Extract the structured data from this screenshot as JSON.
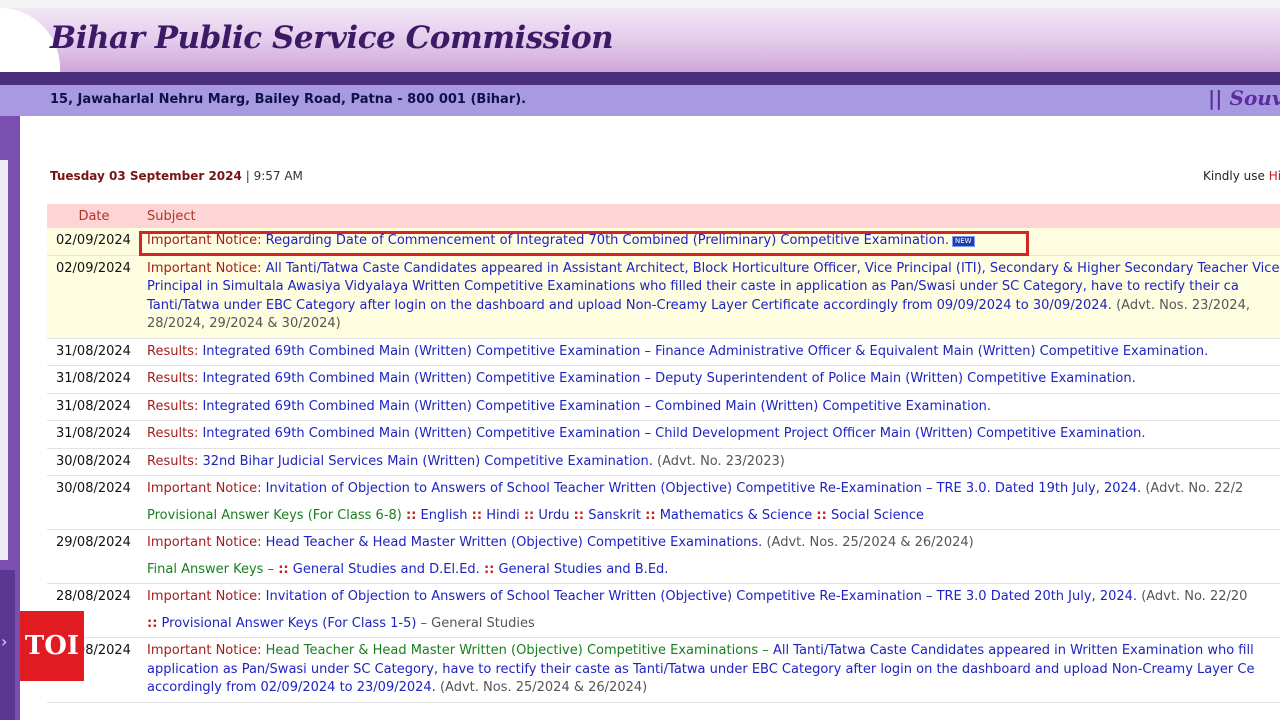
{
  "header": {
    "title": "Bihar Public Service Commission",
    "address": "15, Jawaharlal Nehru Marg, Bailey Road, Patna - 800 001 (Bihar).",
    "souvenir": "|| Souve"
  },
  "info_bar": {
    "date": "Tuesday 03 September 2024",
    "separator": "|",
    "time": "9:57 AM",
    "kindly_text": "Kindly use",
    "kindly_link": "Hin"
  },
  "table": {
    "col_date": "Date",
    "col_subject": "Subject",
    "rows": [
      {
        "date": "02/09/2024",
        "category": "Important Notice:",
        "text": "Regarding Date of Commencement of Integrated 70th Combined (Preliminary) Competitive Examination.",
        "badge": "NEW"
      },
      {
        "date": "02/09/2024",
        "category": "Important Notice:",
        "text": "All Tanti/Tatwa Caste Candidates appeared in Assistant Architect, Block Horticulture Officer, Vice Principal (ITI), Secondary & Higher Secondary Teacher Vice Principal in Simultala Awasiya Vidyalaya Written Competitive Examinations who filled their caste in application as Pan/Swasi under SC Category, have to rectify their ca Tanti/Tatwa under EBC Category after login on the dashboard and upload Non-Creamy Layer Certificate accordingly from 09/09/2024 to 30/09/2024.",
        "advt": "(Advt. Nos. 23/2024, 28/2024, 29/2024 & 30/2024)"
      },
      {
        "date": "31/08/2024",
        "category": "Results:",
        "text": "Integrated 69th Combined Main (Written) Competitive Examination – Finance Administrative Officer & Equivalent Main (Written) Competitive Examination."
      },
      {
        "date": "31/08/2024",
        "category": "Results:",
        "text": "Integrated 69th Combined Main (Written) Competitive Examination – Deputy Superintendent of Police Main (Written) Competitive Examination."
      },
      {
        "date": "31/08/2024",
        "category": "Results:",
        "text": "Integrated 69th Combined Main (Written) Competitive Examination – Combined Main (Written) Competitive Examination."
      },
      {
        "date": "31/08/2024",
        "category": "Results:",
        "text": "Integrated 69th Combined Main (Written) Competitive Examination – Child Development Project Officer Main (Written) Competitive Examination."
      },
      {
        "date": "30/08/2024",
        "category": "Results:",
        "text": "32nd Bihar Judicial Services Main (Written) Competitive Examination.",
        "advt": "(Advt. No. 23/2023)"
      },
      {
        "date": "30/08/2024",
        "category": "Important Notice:",
        "text": "Invitation of Objection to Answers of School Teacher Written (Objective) Competitive Re-Examination – TRE 3.0. Dated 19th July, 2024.",
        "advt": "(Advt. No. 22/2",
        "sub": {
          "label": "Provisional Answer Keys (For Class 6-8)",
          "sep": "::",
          "links": [
            "English",
            "Hindi",
            "Urdu",
            "Sanskrit",
            "Mathematics & Science",
            "Social Science"
          ]
        }
      },
      {
        "date": "29/08/2024",
        "category": "Important Notice:",
        "text": "Head Teacher & Head Master Written (Objective) Competitive Examinations.",
        "advt": "(Advt. Nos. 25/2024 & 26/2024)",
        "sub": {
          "label": "Final Answer Keys –",
          "sep": "::",
          "links": [
            "General Studies and D.El.Ed.",
            "General Studies and B.Ed."
          ]
        }
      },
      {
        "date": "28/08/2024",
        "category": "Important Notice:",
        "text": "Invitation of Objection to Answers of School Teacher Written (Objective) Competitive Re-Examination – TRE 3.0 Dated 20th July, 2024.",
        "advt": "(Advt. No. 22/20",
        "sub": {
          "sep": "::",
          "link": "Provisional Answer Keys (For Class 1-5)",
          "dash": "– General Studies"
        }
      },
      {
        "date": "28/08/2024",
        "category": "Important Notice:",
        "text_green": "Head Teacher & Head Master Written (Objective) Competitive Examinations –",
        "text": "All Tanti/Tatwa Caste Candidates appeared in Written Examination who fill application as Pan/Swasi under SC Category, have to rectify their caste as Tanti/Tatwa under EBC Category after login on the dashboard and upload Non-Creamy Layer Ce accordingly from 02/09/2024 to 23/09/2024.",
        "advt": "(Advt. Nos. 25/2024 & 26/2024)"
      }
    ]
  },
  "watermark": {
    "label": "TOI",
    "color": "#e11b22"
  },
  "colors": {
    "header_title": "#3c1a66",
    "address_bar": "#a79ae0",
    "divider": "#4b2f7c",
    "link_blue": "#1d24c2",
    "link_green": "#187f1e",
    "category_red": "#a51c1c",
    "highlight": "#d32525"
  }
}
